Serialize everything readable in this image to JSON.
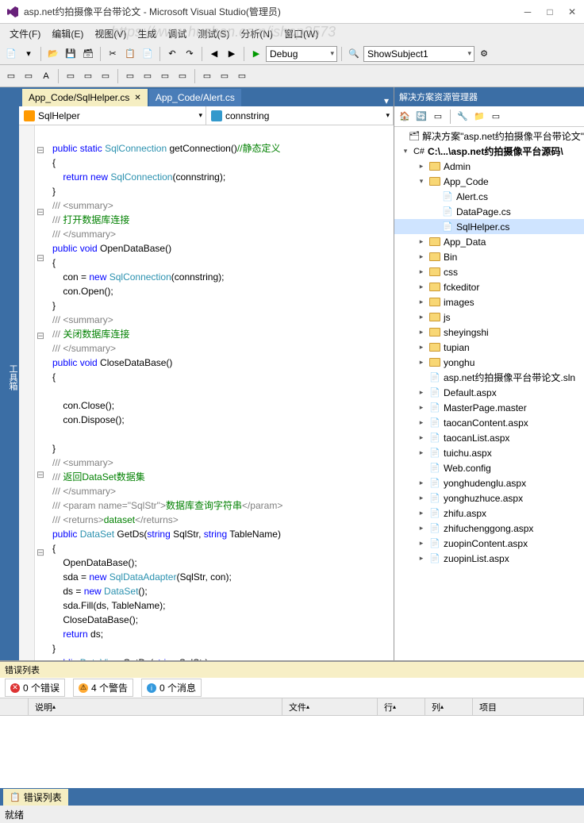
{
  "window": {
    "title": "asp.net约拍摄像平台带论文 - Microsoft Visual Studio(管理员)"
  },
  "watermark": "https://www.huzhan.com/ishop3573",
  "menu": {
    "file": "文件(F)",
    "edit": "编辑(E)",
    "view": "视图(V)",
    "build": "生成",
    "debug": "调试",
    "test": "测试(S)",
    "analyze": "分析(N)",
    "window": "窗口(W)"
  },
  "toolbar": {
    "config": "Debug",
    "target": "ShowSubject1"
  },
  "sidebar_label": "工具箱",
  "tabs": [
    {
      "label": "App_Code/SqlHelper.cs",
      "active": true
    },
    {
      "label": "App_Code/Alert.cs",
      "active": false
    }
  ],
  "nav": {
    "left": "SqlHelper",
    "right": "connstring"
  },
  "solution": {
    "title": "解决方案资源管理器",
    "root": "解决方案\"asp.net约拍摄像平台带论文\"",
    "project": "C:\\...\\asp.net约拍摄像平台源码\\",
    "folders": {
      "admin": "Admin",
      "app_code": "App_Code",
      "app_data": "App_Data",
      "bin": "Bin",
      "css": "css",
      "fckeditor": "fckeditor",
      "images": "images",
      "js": "js",
      "sheyingshi": "sheyingshi",
      "tupian": "tupian",
      "yonghu": "yonghu"
    },
    "app_code_files": {
      "alert": "Alert.cs",
      "datapage": "DataPage.cs",
      "sqlhelper": "SqlHelper.cs"
    },
    "files": {
      "sln": "asp.net约拍摄像平台带论文.sln",
      "default": "Default.aspx",
      "master": "MasterPage.master",
      "taocan_content": "taocanContent.aspx",
      "taocan_list": "taocanList.aspx",
      "tuichu": "tuichu.aspx",
      "webconfig": "Web.config",
      "yonghu_denglu": "yonghudenglu.aspx",
      "yonghu_zhuce": "yonghuzhuce.aspx",
      "zhifu": "zhifu.aspx",
      "zhifu_cg": "zhifuchenggong.aspx",
      "zuopin_content": "zuopinContent.aspx",
      "zuopin_list": "zuopinList.aspx"
    }
  },
  "errors": {
    "title": "错误列表",
    "err_count": "0 个错误",
    "warn_count": "4 个警告",
    "info_count": "0 个消息",
    "col_desc": "说明",
    "col_file": "文件",
    "col_line": "行",
    "col_col": "列",
    "col_proj": "项目",
    "tab": "错误列表"
  },
  "status": "就绪"
}
